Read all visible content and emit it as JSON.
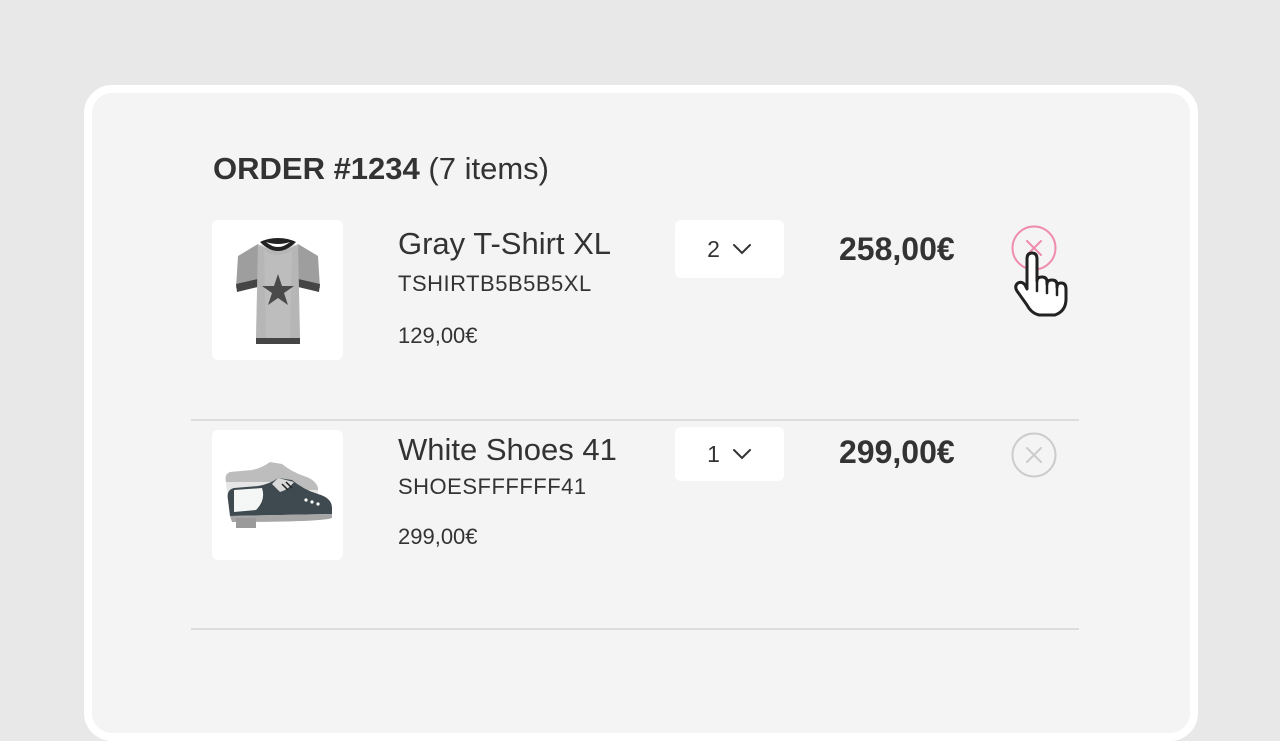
{
  "order": {
    "number_label": "ORDER #1234",
    "count_label": "(7 items)"
  },
  "items": [
    {
      "name": "Gray T-Shirt XL",
      "sku": "TSHIRTB5B5B5XL",
      "unit_price": "129,00€",
      "quantity": "2",
      "total": "258,00€",
      "image_icon": "tshirt-icon",
      "remove_state": "hover"
    },
    {
      "name": "White Shoes 41",
      "sku": "SHOESFFFFFF41",
      "unit_price": "299,00€",
      "quantity": "1",
      "total": "299,00€",
      "image_icon": "shoes-icon",
      "remove_state": "default"
    }
  ],
  "icons": {
    "quantity_dropdown": "chevron-down-icon",
    "remove": "close-circle-icon",
    "pointer": "hand-pointer-icon"
  },
  "colors": {
    "background": "#e8e8e8",
    "card": "#f4f4f4",
    "card_border": "#ffffff",
    "remove_hover": "#f08cab",
    "remove_default": "#cccccc",
    "text": "#333333"
  }
}
